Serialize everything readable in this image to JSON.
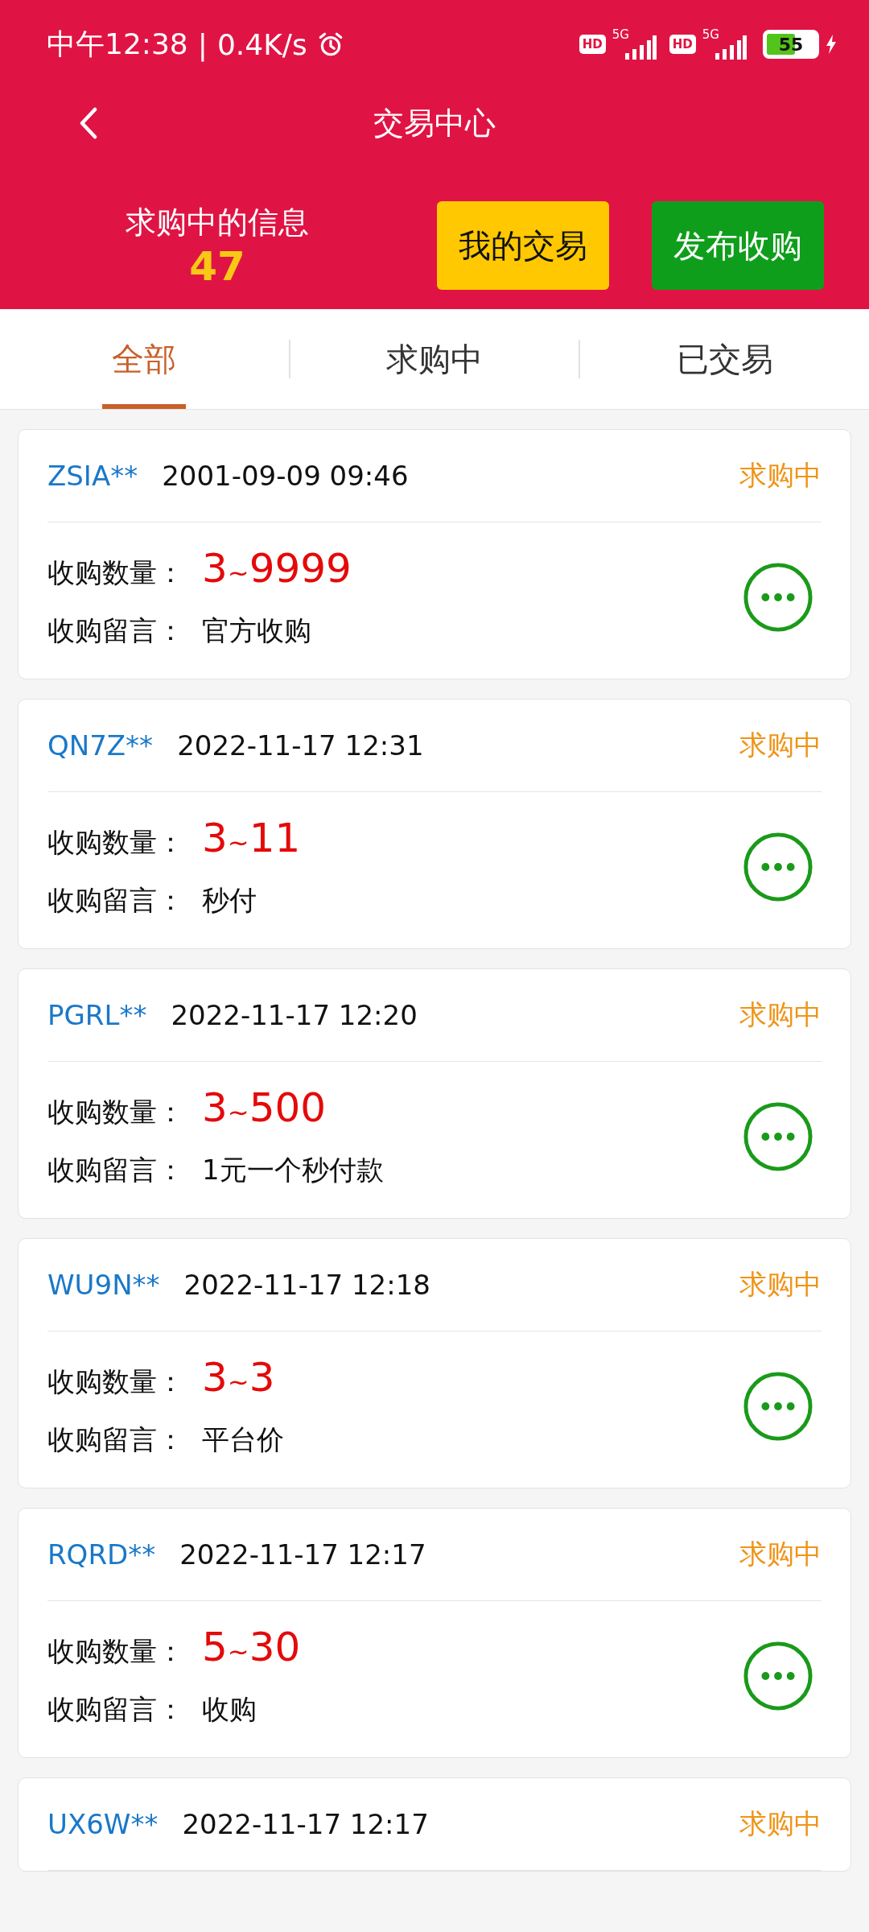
{
  "status_bar": {
    "time": "中午12:38",
    "separator": "|",
    "speed": "0.4K/s",
    "sim": [
      {
        "hd": "HD",
        "network": "5G"
      },
      {
        "hd": "HD",
        "network": "5G"
      }
    ],
    "battery": {
      "label": "55",
      "level": 0.55,
      "charging": true
    }
  },
  "header": {
    "title": "交易中心",
    "counter_label": "求购中的信息",
    "counter_value": "47",
    "buttons": [
      {
        "label": "我的交易",
        "kind": "yellow"
      },
      {
        "label": "发布收购",
        "kind": "green"
      }
    ]
  },
  "tabs": [
    {
      "label": "全部",
      "selected": true
    },
    {
      "label": "求购中",
      "selected": false
    },
    {
      "label": "已交易",
      "selected": false
    }
  ],
  "orders": [
    {
      "user": "ZSIA**",
      "time": "2001-09-09 09:46",
      "status": "求购中",
      "quantity_label": "收购数量：",
      "quantity": "3~9999",
      "message_label": "收购留言：",
      "message": "官方收购"
    },
    {
      "user": "QN7Z**",
      "time": "2022-11-17 12:31",
      "status": "求购中",
      "quantity_label": "收购数量：",
      "quantity": "3~11",
      "message_label": "收购留言：",
      "message": "秒付"
    },
    {
      "user": "PGRL**",
      "time": "2022-11-17 12:20",
      "status": "求购中",
      "quantity_label": "收购数量：",
      "quantity": "3~500",
      "message_label": "收购留言：",
      "message": "1元一个秒付款"
    },
    {
      "user": "WU9N**",
      "time": "2022-11-17 12:18",
      "status": "求购中",
      "quantity_label": "收购数量：",
      "quantity": "3~3",
      "message_label": "收购留言：",
      "message": "平台价"
    },
    {
      "user": "RQRD**",
      "time": "2022-11-17 12:17",
      "status": "求购中",
      "quantity_label": "收购数量：",
      "quantity": "5~30",
      "message_label": "收购留言：",
      "message": "收购"
    },
    {
      "user": "UX6W**",
      "time": "2022-11-17 12:17",
      "status": "求购中"
    }
  ]
}
